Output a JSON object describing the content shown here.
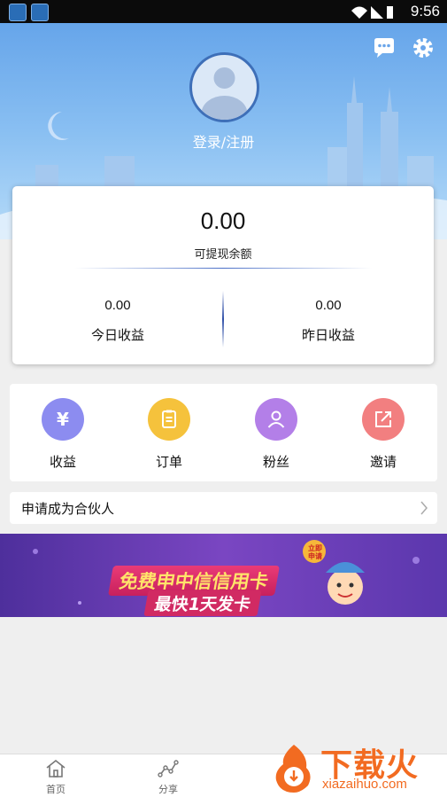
{
  "statusbar": {
    "time": "9:56"
  },
  "header": {
    "login_label": "登录/注册"
  },
  "balance": {
    "value": "0.00",
    "label": "可提现余额"
  },
  "stats": [
    {
      "value": "0.00",
      "label": "今日收益"
    },
    {
      "value": "0.00",
      "label": "昨日收益"
    }
  ],
  "menu": [
    {
      "label": "收益",
      "icon": "yen-icon",
      "color": "#8c8cf0"
    },
    {
      "label": "订单",
      "icon": "clipboard-icon",
      "color": "#f5c23c"
    },
    {
      "label": "粉丝",
      "icon": "user-icon",
      "color": "#b37fe8"
    },
    {
      "label": "邀请",
      "icon": "share-icon",
      "color": "#f27f80"
    }
  ],
  "partner": {
    "label": "申请成为合伙人"
  },
  "banner": {
    "title": "免费申中信信用卡",
    "subtitle": "最快1天发卡",
    "badge": "立即申请"
  },
  "tabbar": {
    "tabs": [
      {
        "label": "首页",
        "icon": "home-icon"
      },
      {
        "label": "分享",
        "icon": "share-graph-icon"
      }
    ]
  },
  "watermark": {
    "text": "下载火",
    "url": "xiazaihuo.com"
  }
}
